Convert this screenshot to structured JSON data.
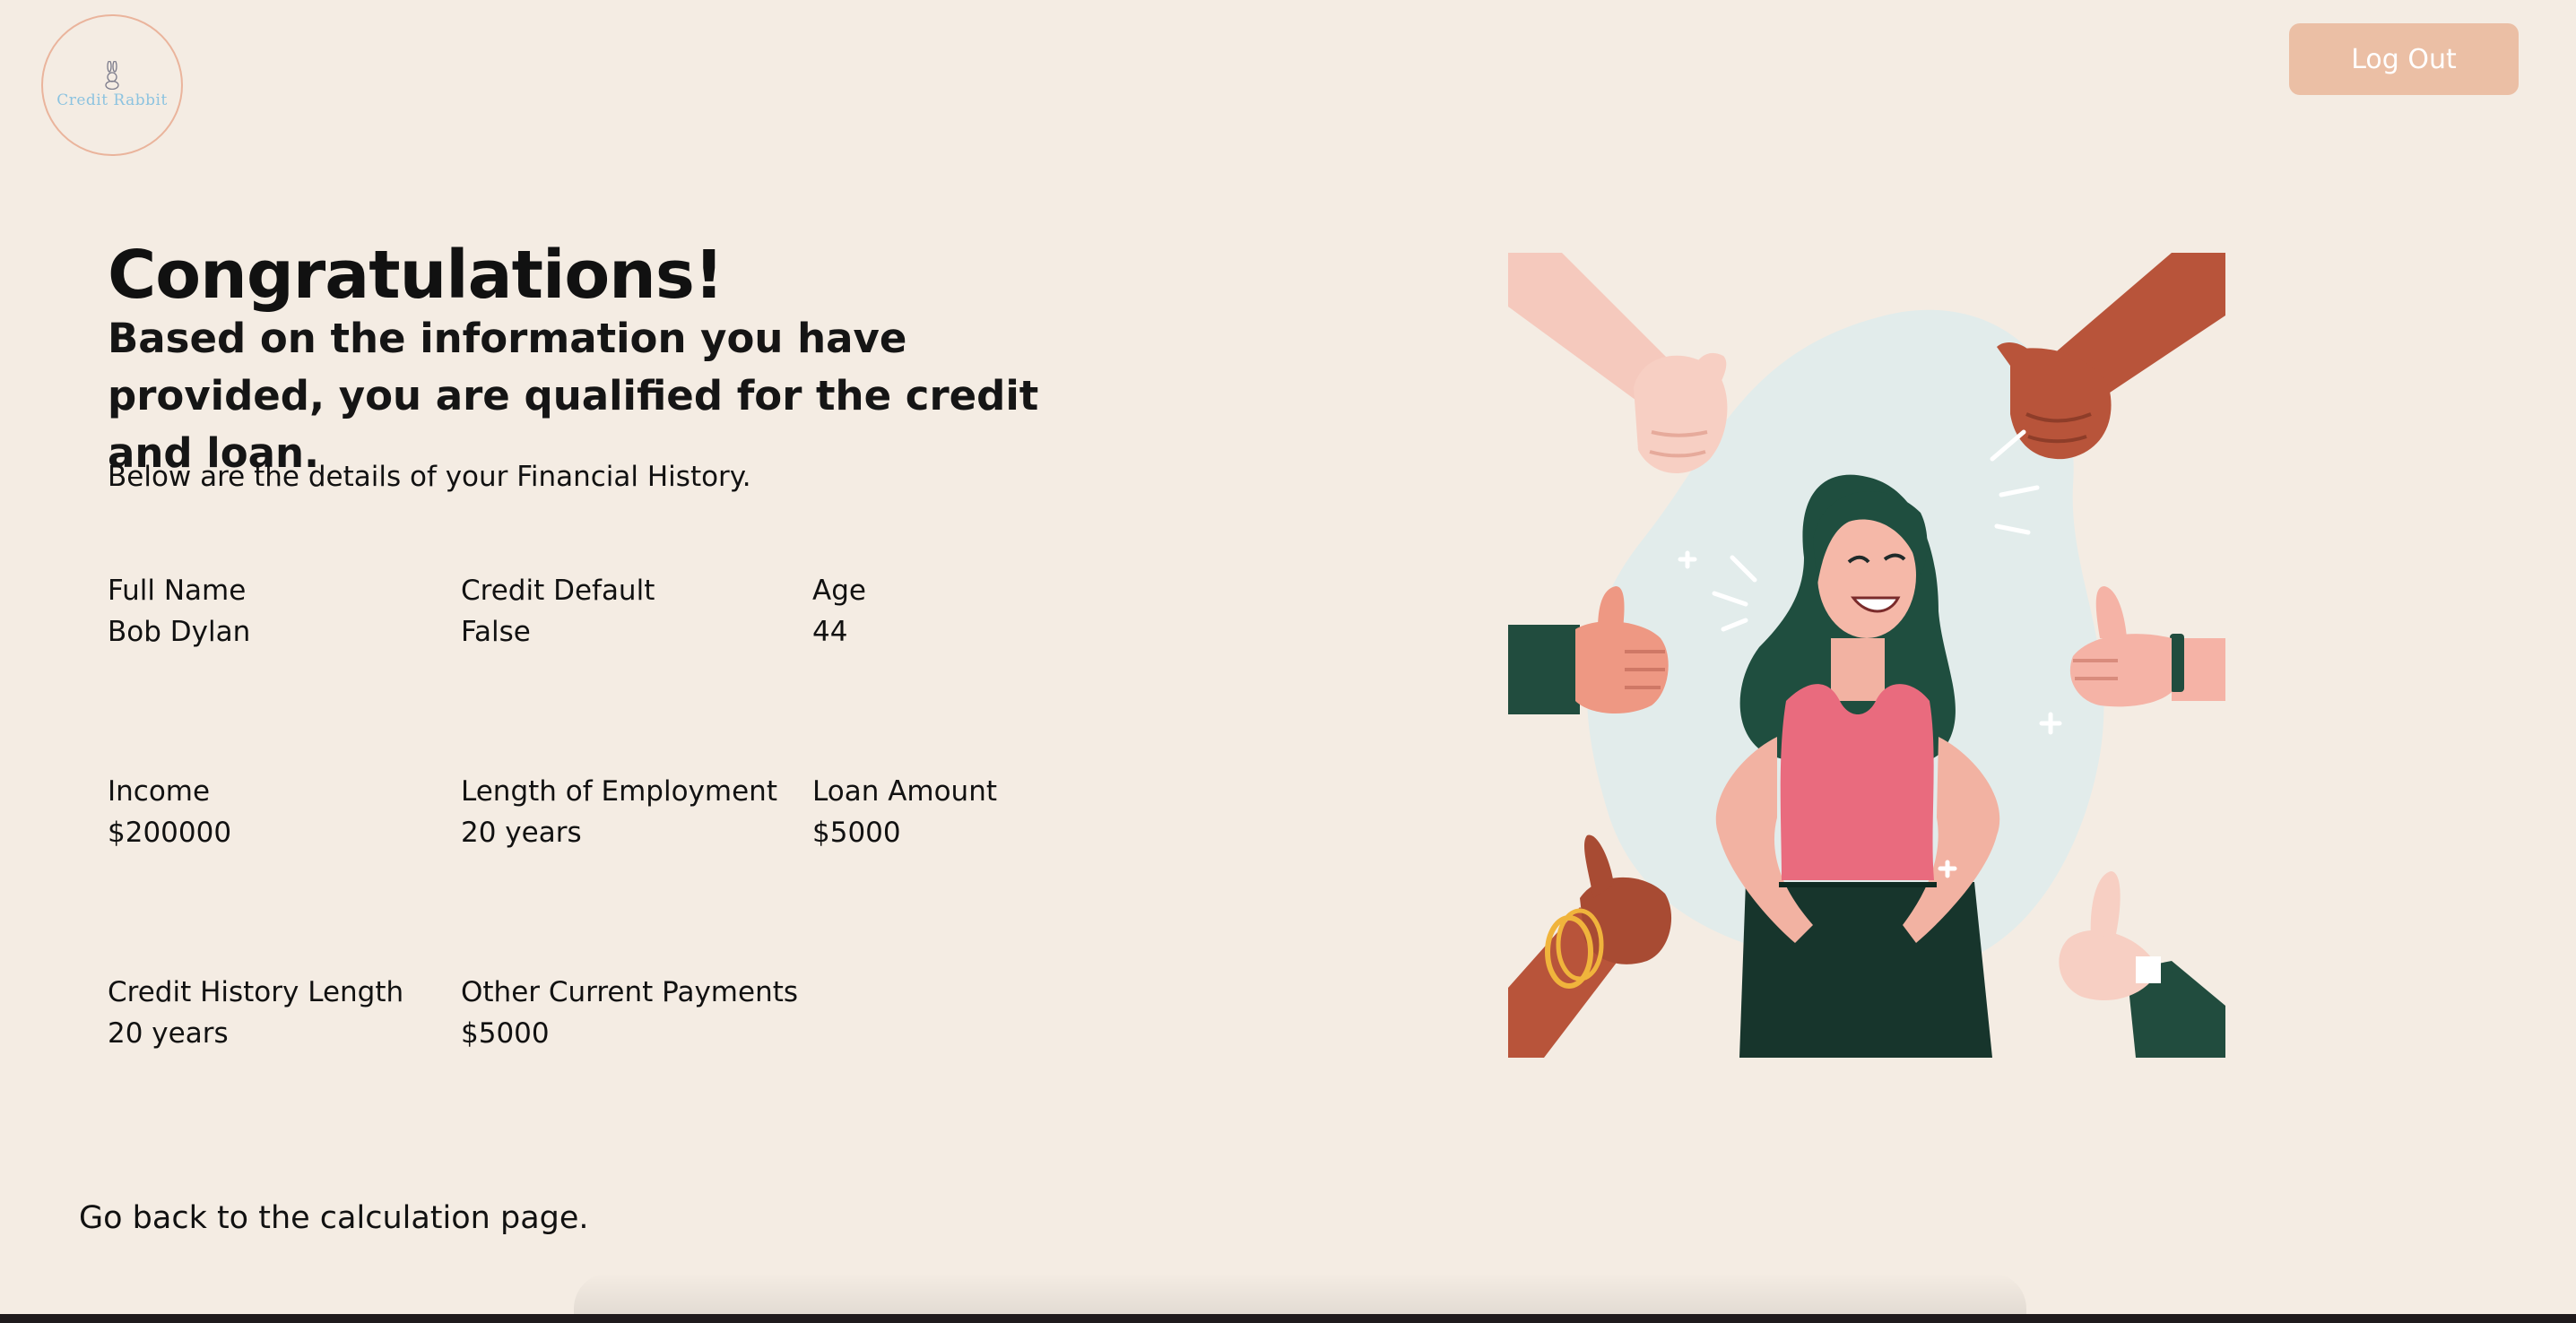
{
  "header": {
    "logo_text": "Credit Rabbit",
    "logout_label": "Log Out"
  },
  "main": {
    "title": "Congratulations!",
    "subtitle": "Based on the information you have provided, you are qualified for the credit and loan.",
    "intro": "Below are the details of your Financial History.",
    "fields": [
      {
        "label": "Full Name",
        "value": "Bob Dylan"
      },
      {
        "label": "Credit Default",
        "value": "False"
      },
      {
        "label": "Age",
        "value": "44"
      },
      {
        "label": "Income",
        "value": "$200000"
      },
      {
        "label": "Length of Employment",
        "value": "20 years"
      },
      {
        "label": "Loan Amount",
        "value": "$5000"
      },
      {
        "label": "Credit History Length",
        "value": "20 years"
      },
      {
        "label": "Other Current Payments",
        "value": "$5000"
      }
    ],
    "back_link": "Go back to the calculation page."
  },
  "colors": {
    "background": "#f4ece3",
    "logout_button": "#ebbfa5",
    "logo_border": "#eab49c",
    "logo_text": "#8cc3e0"
  },
  "icons": [
    "rabbit-icon"
  ]
}
